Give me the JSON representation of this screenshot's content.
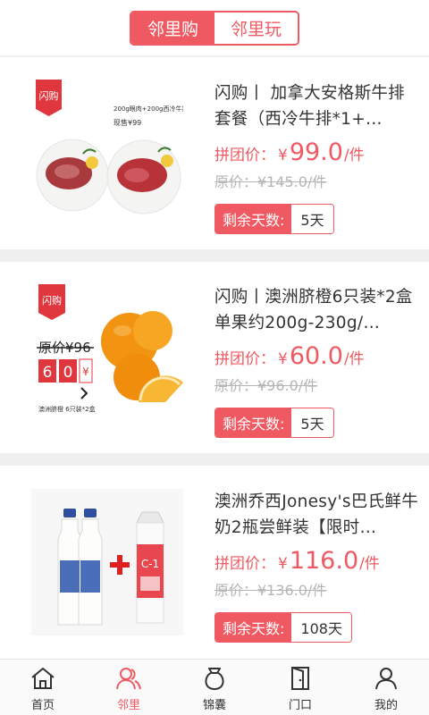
{
  "header": {
    "tabs": [
      {
        "label": "邻里购",
        "active": true
      },
      {
        "label": "邻里玩",
        "active": false
      }
    ]
  },
  "colors": {
    "accent": "#ef5a62",
    "text": "#333333",
    "muted": "#b5b5b5"
  },
  "products": [
    {
      "title": "闪购丨 加拿大安格斯牛排套餐（西冷牛排*1+…",
      "price_label": "拼团价：",
      "currency": "¥",
      "price": "99.0",
      "unit": "/件",
      "original_price": "原价：¥145.0/件",
      "days_label": "剩余天数:",
      "days_value": "5天",
      "image": {
        "badge": "闪购",
        "caption_line1": "200g眼肉+200g西冷牛排",
        "caption_line2": "现售¥99"
      }
    },
    {
      "title": "闪购丨澳洲脐橙6只装*2盒 单果约200g-230g/…",
      "price_label": "拼团价：",
      "currency": "¥",
      "price": "60.0",
      "unit": "/件",
      "original_price": "原价：¥96.0/件",
      "days_label": "剩余天数:",
      "days_value": "5天",
      "image": {
        "badge": "闪购",
        "orig_tag": "原价¥96",
        "digit1": "6",
        "digit2": "0",
        "yen": "¥",
        "caption": "澳洲脐橙 6只装*2盒"
      }
    },
    {
      "title": "澳洲乔西Jonesy's巴氏鲜牛奶2瓶尝鲜装【限时…",
      "price_label": "拼团价：",
      "currency": "¥",
      "price": "116.0",
      "unit": "/件",
      "original_price": "原价：¥136.0/件",
      "days_label": "剩余天数:",
      "days_value": "108天",
      "image": {
        "carton_text": "C-1"
      }
    }
  ],
  "tabbar": {
    "items": [
      {
        "label": "首页",
        "icon": "home-icon",
        "active": false
      },
      {
        "label": "邻里",
        "icon": "neighbors-icon",
        "active": true
      },
      {
        "label": "锦囊",
        "icon": "pouch-icon",
        "active": false
      },
      {
        "label": "门口",
        "icon": "door-icon",
        "active": false
      },
      {
        "label": "我的",
        "icon": "profile-icon",
        "active": false
      }
    ]
  }
}
